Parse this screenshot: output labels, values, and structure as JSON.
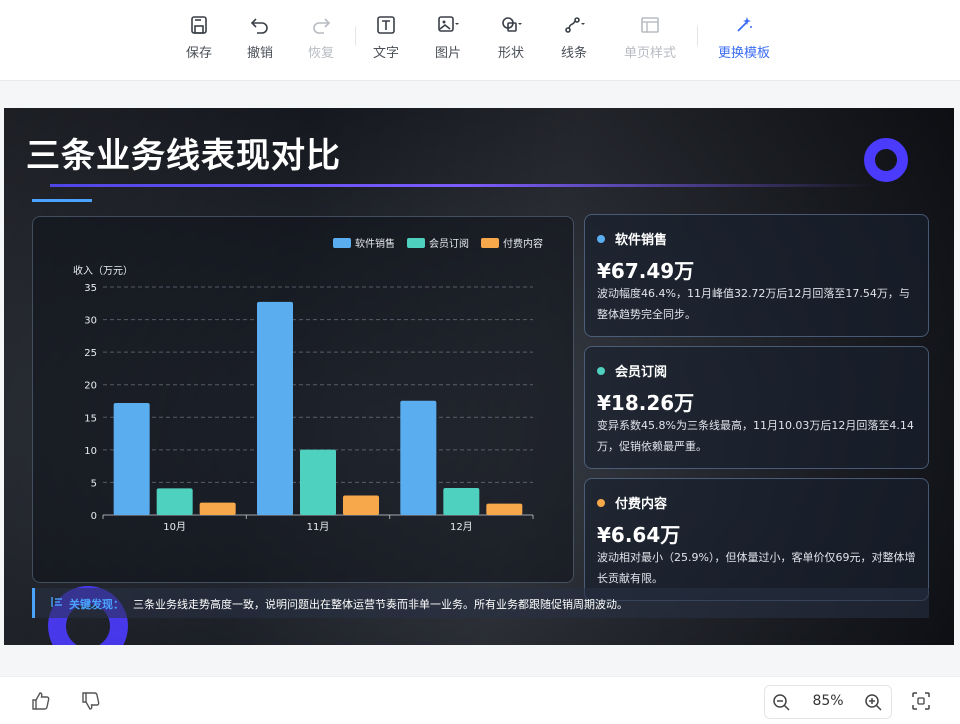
{
  "toolbar": {
    "save": "保存",
    "undo": "撤销",
    "redo": "恢复",
    "text": "文字",
    "image": "图片",
    "shape": "形状",
    "line": "线条",
    "page_style": "单页样式",
    "change_template": "更换模板"
  },
  "slide": {
    "title": "三条业务线表现对比",
    "finding_label": "关键发现：",
    "finding_text": "三条业务线走势高度一致，说明问题出在整体运营节奏而非单一业务。所有业务都跟随促销周期波动。"
  },
  "cards": [
    {
      "name": "软件销售",
      "value": "¥67.49万",
      "desc": "波动幅度46.4%，11月峰值32.72万后12月回落至17.54万，与整体趋势完全同步。",
      "color": "#5aaef0"
    },
    {
      "name": "会员订阅",
      "value": "¥18.26万",
      "desc": "变异系数45.8%为三条线最高，11月10.03万后12月回落至4.14万，促销依赖最严重。",
      "color": "#4fd1c0"
    },
    {
      "name": "付费内容",
      "value": "¥6.64万",
      "desc": "波动相对最小（25.9%），但体量过小，客单价仅69元，对整体增长贡献有限。",
      "color": "#f6a84b"
    }
  ],
  "chart_data": {
    "type": "bar",
    "categories": [
      "10月",
      "11月",
      "12月"
    ],
    "series": [
      {
        "name": "软件销售",
        "values": [
          17.2,
          32.72,
          17.54
        ],
        "color": "#5aaef0"
      },
      {
        "name": "会员订阅",
        "values": [
          4.09,
          10.03,
          4.14
        ],
        "color": "#4fd1c0"
      },
      {
        "name": "付费内容",
        "values": [
          1.9,
          3.0,
          1.74
        ],
        "color": "#f6a84b"
      }
    ],
    "ylabel": "收入（万元）",
    "ylim": [
      0,
      35
    ],
    "yticks": [
      0,
      5,
      10,
      15,
      20,
      25,
      30,
      35
    ],
    "grid": true,
    "legend": "top-right"
  },
  "zoom": {
    "level": "85%"
  }
}
